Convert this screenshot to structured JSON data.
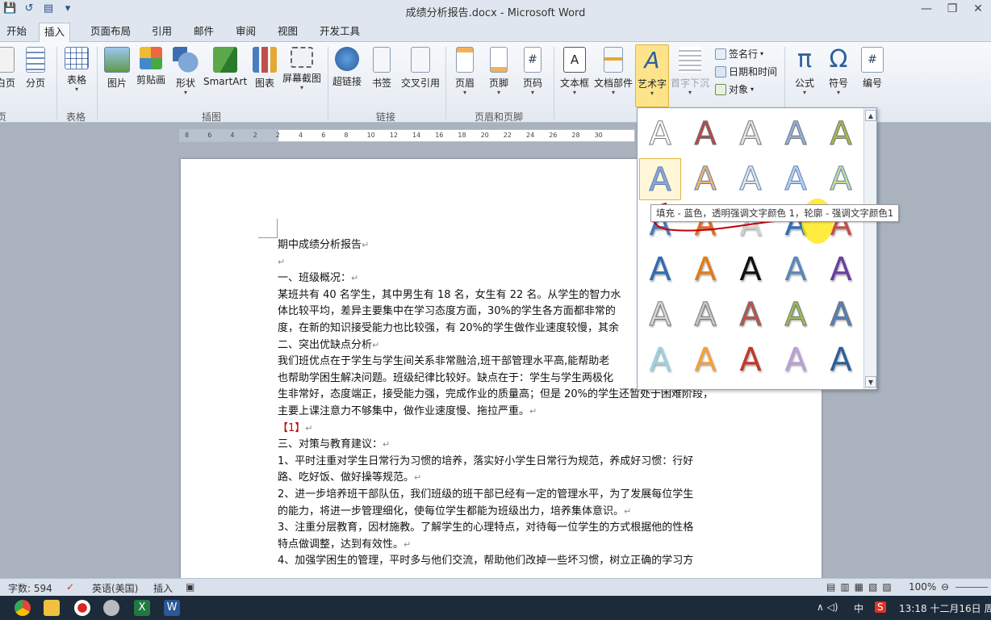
{
  "window": {
    "title": "成绩分析报告.docx - Microsoft Word",
    "minimize": "—",
    "restore": "❐",
    "close": "✕"
  },
  "tabs": [
    "开始",
    "插入",
    "页面布局",
    "引用",
    "邮件",
    "审阅",
    "视图",
    "开发工具"
  ],
  "active_tab": "插入",
  "ribbon": {
    "pages": {
      "blank_page": "白页",
      "page_break": "分页",
      "group": "页"
    },
    "tables": {
      "table": "表格",
      "group": "表格"
    },
    "illustrations": {
      "picture": "图片",
      "clipart": "剪贴画",
      "shapes": "形状",
      "smartart": "SmartArt",
      "chart": "图表",
      "screenshot": "屏幕截图",
      "group": "插图"
    },
    "links": {
      "hyperlink": "超链接",
      "bookmark": "书签",
      "crossref": "交叉引用",
      "group": "链接"
    },
    "header_footer": {
      "header": "页眉",
      "footer": "页脚",
      "page_number": "页码",
      "group": "页眉和页脚"
    },
    "text": {
      "textbox": "文本框",
      "quickparts": "文档部件",
      "wordart": "艺术字",
      "dropcap": "首字下沉",
      "signature": "签名行",
      "datetime": "日期和时间",
      "object": "对象"
    },
    "symbols": {
      "equation": "公式",
      "symbol": "符号",
      "number": "编号"
    }
  },
  "ruler_ticks": [
    "8",
    "6",
    "4",
    "2",
    "2",
    "4",
    "6",
    "8",
    "10",
    "12",
    "14",
    "16",
    "18",
    "20",
    "22",
    "24",
    "26",
    "28",
    "30"
  ],
  "document": {
    "lines": [
      {
        "text": "期中成绩分析报告",
        "mark": "↵"
      },
      {
        "text": "",
        "mark": "↵"
      },
      {
        "text": "一、班级概况：",
        "mark": "↵"
      },
      {
        "text": "某班共有 40 名学生，其中男生有 18 名，女生有 22 名。从学生的智力水",
        "mark": ""
      },
      {
        "text": "体比较平均，差异主要集中在学习态度方面，30%的学生各方面都非常的",
        "mark": ""
      },
      {
        "text": "度，在新的知识接受能力也比较强，有 20%的学生做作业速度较慢，其余",
        "mark": ""
      },
      {
        "text": "二、突出优缺点分析",
        "mark": "↵"
      },
      {
        "text": "我们班优点在于学生与学生间关系非常融洽,班干部管理水平高,能帮助老",
        "mark": ""
      },
      {
        "text": "也帮助学困生解决问题。班级纪律比较好。缺点在于：学生与学生两极化",
        "mark": ""
      },
      {
        "text": "生非常好，态度端正，接受能力强，完成作业的质量高；但是 20%的学生还暂处于困难阶段，",
        "mark": ""
      },
      {
        "text": "主要上课注意力不够集中，做作业速度慢、拖拉严重。",
        "mark": "↵"
      },
      {
        "text": "【1】",
        "mark": "↵",
        "red": true
      },
      {
        "text": "三、对策与教育建议：",
        "mark": "↵"
      },
      {
        "text": "1、平时注重对学生日常行为习惯的培养，落实好小学生日常行为规范，养成好习惯：行好",
        "mark": ""
      },
      {
        "text": "路、吃好饭、做好操等规范。",
        "mark": "↵"
      },
      {
        "text": "2、进一步培养班干部队伍，我们班级的班干部已经有一定的管理水平，为了发展每位学生",
        "mark": ""
      },
      {
        "text": "的能力，将进一步管理细化，使每位学生都能为班级出力，培养集体意识。",
        "mark": "↵"
      },
      {
        "text": "3、注重分层教育，因材施教。了解学生的心理特点，对待每一位学生的方式根据他的性格",
        "mark": ""
      },
      {
        "text": "特点做调整，达到有效性。",
        "mark": "↵"
      },
      {
        "text": "4、加强学困生的管理，平时多与他们交流，帮助他们改掉一些坏习惯，树立正确的学习方",
        "mark": ""
      }
    ]
  },
  "gallery": {
    "glyph": "A",
    "tooltip": "填充 - 蓝色，透明强调文字颜色 1，轮廓 - 强调文字颜色1",
    "styles": [
      [
        "#8aa3c6",
        "#b24a4a",
        "#e3e3e3",
        "#8fb0dd",
        "#9dbb52"
      ],
      [
        "#8ea8d4",
        "#f1b56a",
        "#e3e3e3",
        "#b9d0ee",
        "#c8dc94"
      ],
      [
        "#4a78b8",
        "#e06a2a",
        "#d0d0d0",
        "#2d6fb5",
        "#c0504d"
      ],
      [
        "#2f6db3",
        "#e07b1a",
        "#111111",
        "#5a86b8",
        "#6a3fa0"
      ],
      [
        "#d8d8d8",
        "#c8c8c8",
        "#c0504d",
        "#9bbb59",
        "#4f81bd"
      ],
      [
        "#9fd0e0",
        "#f1a13c",
        "#c0392b",
        "#b9a0d8",
        "#2f5f9a"
      ]
    ]
  },
  "status": {
    "word_count": "字数: 594",
    "language": "英语(美国)",
    "mode": "插入",
    "zoom": "100%"
  },
  "taskbar": {
    "time": "13:18 十二月16日 周",
    "ime": "中"
  }
}
